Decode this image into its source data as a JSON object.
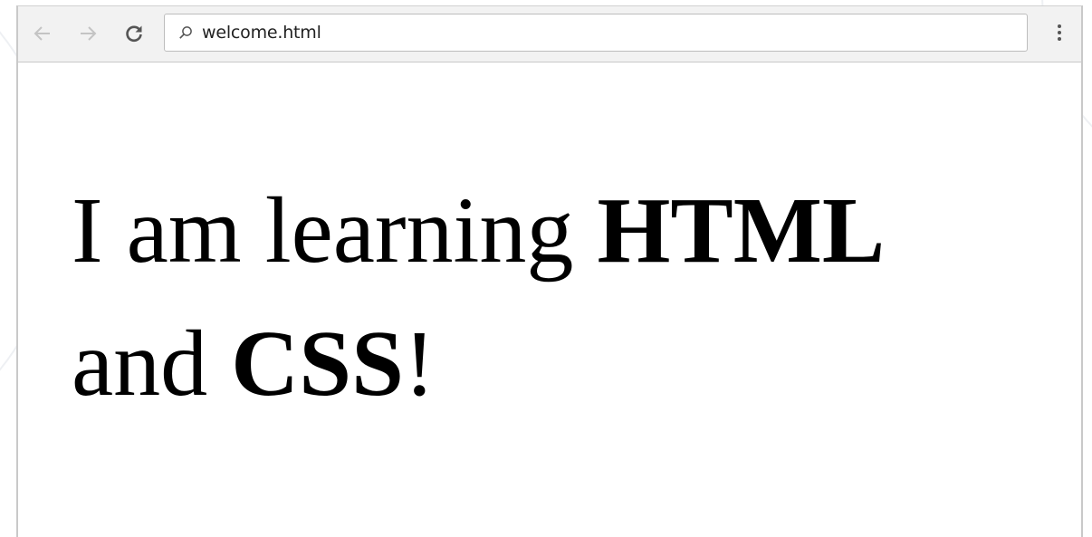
{
  "browser": {
    "address_bar": {
      "url": "welcome.html"
    },
    "icons": {
      "back": "arrow-left-icon",
      "forward": "arrow-right-icon",
      "reload": "reload-icon",
      "search": "search-icon",
      "menu": "kebab-menu-icon"
    }
  },
  "page": {
    "text_1": "I am learning ",
    "bold_1": "HTML",
    "text_2": " and ",
    "bold_2": "CSS",
    "text_3": "!"
  },
  "colors": {
    "toolbar_bg": "#f2f2f2",
    "page_bg": "#ffffff",
    "text": "#000000",
    "inactive_nav": "#c4c4c4"
  }
}
